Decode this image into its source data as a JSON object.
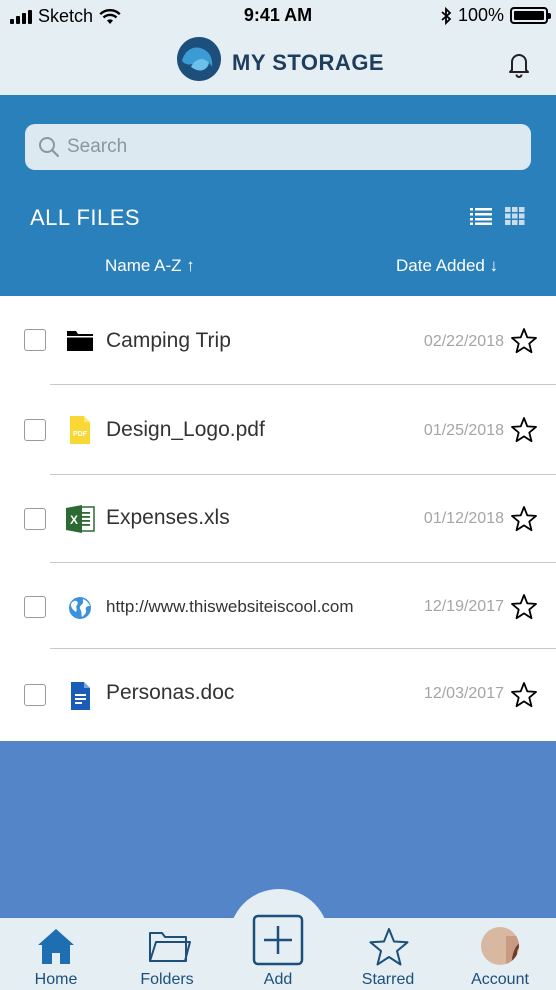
{
  "status_bar": {
    "carrier": "Sketch",
    "time": "9:41 AM",
    "battery": "100%"
  },
  "header": {
    "title": "MY STORAGE"
  },
  "search": {
    "placeholder": "Search"
  },
  "section": {
    "title": "ALL FILES"
  },
  "sort": {
    "name_label": "Name  A-Z ↑",
    "date_label": "Date Added ↓"
  },
  "files": [
    {
      "name": "Camping Trip",
      "date": "02/22/2018",
      "icon": "folder-icon"
    },
    {
      "name": "Design_Logo.pdf",
      "date": "01/25/2018",
      "icon": "pdf-file-icon"
    },
    {
      "name": "Expenses.xls",
      "date": "01/12/2018",
      "icon": "excel-file-icon"
    },
    {
      "name": "http://www.thiswebsiteiscool.com",
      "date": "12/19/2017",
      "icon": "globe-icon"
    },
    {
      "name": "Personas.doc",
      "date": "12/03/2017",
      "icon": "document-icon"
    }
  ],
  "tabs": [
    {
      "label": "Home",
      "icon": "home-icon"
    },
    {
      "label": "Folders",
      "icon": "folder-icon"
    },
    {
      "label": "Add",
      "icon": "add-icon"
    },
    {
      "label": "Starred",
      "icon": "star-icon"
    },
    {
      "label": "Account",
      "icon": "avatar"
    }
  ],
  "colors": {
    "header_bg": "#e4eef3",
    "panel_blue": "#2a80bb",
    "body_blue": "#5585c9",
    "accent": "#1d4f7c"
  }
}
